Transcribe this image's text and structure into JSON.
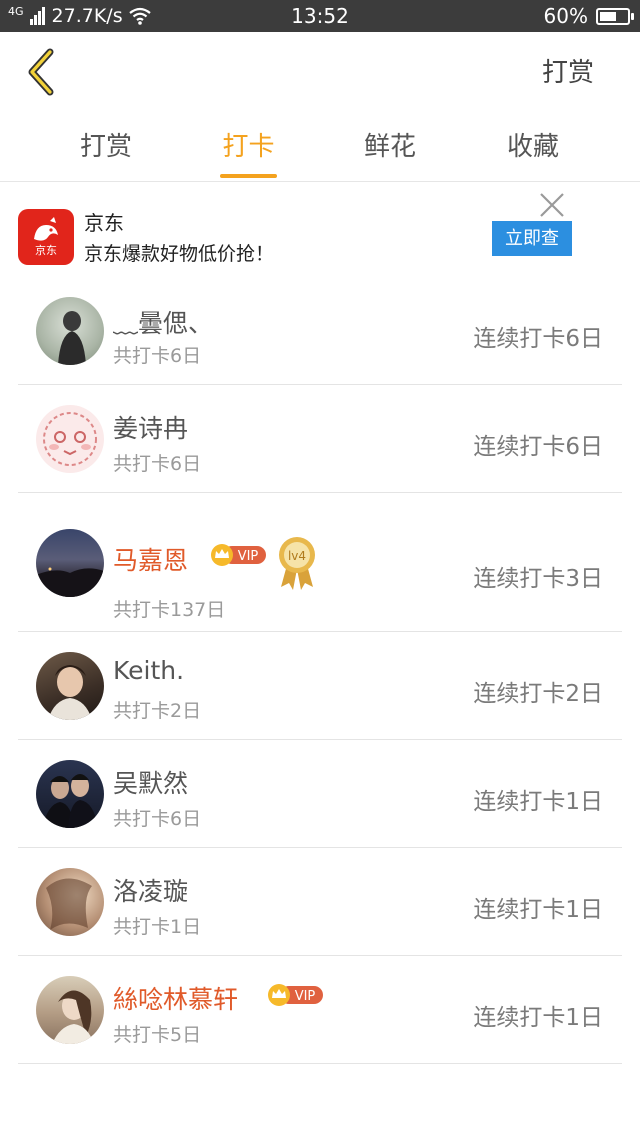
{
  "status_bar": {
    "network": "4G",
    "speed": "27.7K/s",
    "time": "13:52",
    "battery": "60%",
    "battery_level": 0.6
  },
  "header": {
    "back_icon": "chevron-left-icon",
    "action_label": "打赏"
  },
  "tabs": [
    {
      "label": "打赏",
      "active": false
    },
    {
      "label": "打卡",
      "active": true
    },
    {
      "label": "鲜花",
      "active": false
    },
    {
      "label": "收藏",
      "active": false
    }
  ],
  "ad": {
    "logo_text": "京东",
    "title": "京东",
    "description": "京东爆款好物低价抢！",
    "button_label": "立即查",
    "close_icon": "close-icon"
  },
  "list": [
    {
      "name": "﹏曇偲、",
      "total": "共打卡6日",
      "streak": "连续打卡6日",
      "vip": false,
      "medal": false
    },
    {
      "name": "姜诗冉",
      "total": "共打卡6日",
      "streak": "连续打卡6日",
      "vip": false,
      "medal": false
    },
    {
      "name": "马嘉恩",
      "total": "共打卡137日",
      "streak": "连续打卡3日",
      "vip": true,
      "vip_label": "VIP",
      "medal": true,
      "medal_label": "lv4"
    },
    {
      "name": "Keith.",
      "total": "共打卡2日",
      "streak": "连续打卡2日",
      "vip": false,
      "medal": false
    },
    {
      "name": "吴默然",
      "total": "共打卡6日",
      "streak": "连续打卡1日",
      "vip": false,
      "medal": false
    },
    {
      "name": "洛凌璇",
      "total": "共打卡1日",
      "streak": "连续打卡1日",
      "vip": false,
      "medal": false
    },
    {
      "name": "絲唸林慕轩",
      "total": "共打卡5日",
      "streak": "连续打卡1日",
      "vip": true,
      "vip_label": "VIP",
      "medal": false
    }
  ],
  "colors": {
    "accent": "#f4a21e",
    "vip_name": "#e05a2a",
    "ad_button": "#2c8fe0",
    "jd_red": "#e1251b"
  }
}
